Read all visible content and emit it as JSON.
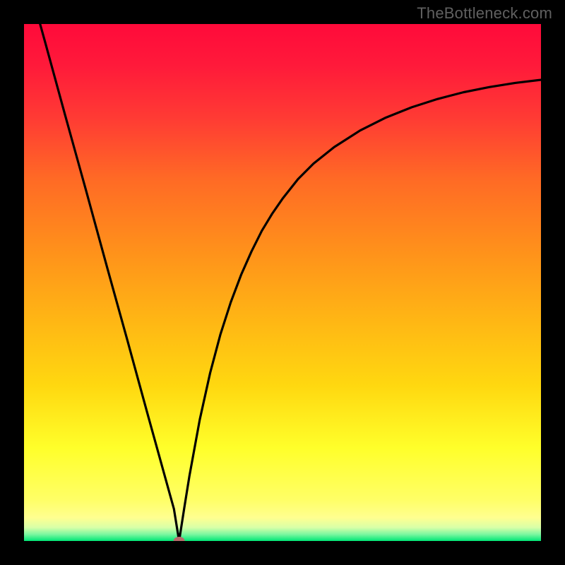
{
  "watermark": "TheBottleneck.com",
  "colors": {
    "frame": "#000000",
    "curve": "#000000",
    "marker": "#b96b6b",
    "gradient_stops": [
      {
        "offset": 0.0,
        "color": "#ff0a3a"
      },
      {
        "offset": 0.08,
        "color": "#ff1a3a"
      },
      {
        "offset": 0.18,
        "color": "#ff3a34"
      },
      {
        "offset": 0.3,
        "color": "#ff6a25"
      },
      {
        "offset": 0.45,
        "color": "#ff941a"
      },
      {
        "offset": 0.58,
        "color": "#ffb814"
      },
      {
        "offset": 0.7,
        "color": "#ffd810"
      },
      {
        "offset": 0.82,
        "color": "#ffff2a"
      },
      {
        "offset": 0.92,
        "color": "#ffff66"
      },
      {
        "offset": 0.955,
        "color": "#ffff90"
      },
      {
        "offset": 0.974,
        "color": "#d8ffa8"
      },
      {
        "offset": 0.987,
        "color": "#7cf7a0"
      },
      {
        "offset": 1.0,
        "color": "#00e676"
      }
    ]
  },
  "chart_data": {
    "type": "line",
    "title": "",
    "xlabel": "",
    "ylabel": "",
    "xlim": [
      0,
      100
    ],
    "ylim": [
      0,
      100
    ],
    "minimum_marker": {
      "x": 30,
      "y": 0
    },
    "series": [
      {
        "name": "curve",
        "x": [
          0,
          2,
          4,
          6,
          8,
          10,
          12,
          14,
          16,
          18,
          20,
          22,
          24,
          26,
          28,
          29,
          30,
          31,
          32,
          34,
          36,
          38,
          40,
          42,
          44,
          46,
          48,
          50,
          53,
          56,
          60,
          65,
          70,
          75,
          80,
          85,
          90,
          95,
          100
        ],
        "y": [
          112,
          104,
          96.8,
          89.5,
          82.2,
          75,
          67.8,
          60.5,
          53.2,
          46,
          38.8,
          31.5,
          24.2,
          17,
          9.8,
          6.2,
          0,
          6.4,
          12.6,
          23.5,
          32.5,
          40,
          46.2,
          51.5,
          56,
          60,
          63.3,
          66.2,
          70,
          73,
          76.2,
          79.4,
          81.9,
          83.9,
          85.5,
          86.8,
          87.8,
          88.6,
          89.2
        ]
      }
    ]
  }
}
